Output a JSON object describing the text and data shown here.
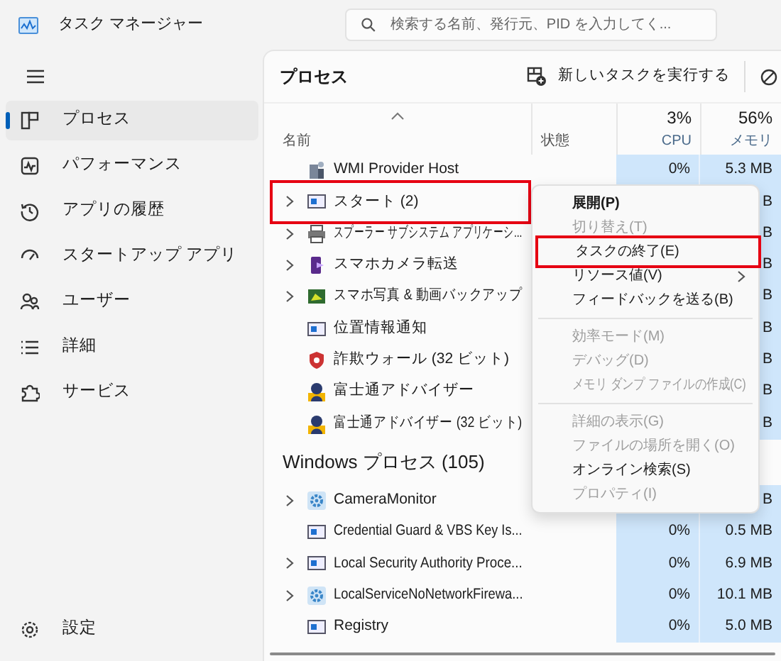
{
  "window": {
    "title": "タスク マネージャー"
  },
  "search": {
    "placeholder": "検索する名前、発行元、PID を入力してく..."
  },
  "sidebar": {
    "items": [
      {
        "label": "プロセス",
        "selected": true
      },
      {
        "label": "パフォーマンス",
        "selected": false
      },
      {
        "label": "アプリの履歴",
        "selected": false
      },
      {
        "label": "スタートアップ アプリ",
        "selected": false
      },
      {
        "label": "ユーザー",
        "selected": false
      },
      {
        "label": "詳細",
        "selected": false
      },
      {
        "label": "サービス",
        "selected": false
      }
    ],
    "footer": {
      "label": "設定"
    }
  },
  "toolbar": {
    "title": "プロセス",
    "run_task": "新しいタスクを実行する"
  },
  "table": {
    "columns": [
      {
        "label": "名前"
      },
      {
        "label": "状態"
      },
      {
        "value": "3%",
        "label": "CPU"
      },
      {
        "value": "56%",
        "label": "メモリ"
      }
    ],
    "rows": [
      {
        "kind": "process",
        "name": "WMI Provider Host",
        "expandable": false,
        "highlighted": false,
        "cpu": "0%",
        "memory": "5.3 MB"
      },
      {
        "kind": "process",
        "name": "スタート (2)",
        "expandable": true,
        "highlighted": true,
        "memory": "B"
      },
      {
        "kind": "process",
        "name": "スプーラー サブシステム アプリケーシ...",
        "expandable": true,
        "highlighted": false,
        "memory": "B"
      },
      {
        "kind": "process",
        "name": "スマホカメラ転送",
        "expandable": true,
        "highlighted": false,
        "memory": "B"
      },
      {
        "kind": "process",
        "name": "スマホ写真 & 動画バックアップ",
        "expandable": true,
        "highlighted": false,
        "memory": "B"
      },
      {
        "kind": "process",
        "name": "位置情報通知",
        "expandable": false,
        "highlighted": false,
        "memory": "B"
      },
      {
        "kind": "process",
        "name": "詐欺ウォール (32 ビット)",
        "expandable": false,
        "highlighted": false,
        "memory": "B"
      },
      {
        "kind": "process",
        "name": "富士通アドバイザー",
        "expandable": false,
        "highlighted": false,
        "memory": "B"
      },
      {
        "kind": "process",
        "name": "富士通アドバイザー (32 ビット)",
        "expandable": false,
        "highlighted": false,
        "memory": "B"
      },
      {
        "kind": "group",
        "name": "Windows プロセス (105)"
      },
      {
        "kind": "process",
        "name": "CameraMonitor",
        "expandable": true,
        "highlighted": false,
        "memory": "B"
      },
      {
        "kind": "process",
        "name": "Credential Guard & VBS Key Is...",
        "expandable": false,
        "highlighted": false,
        "cpu": "0%",
        "memory": "0.5 MB"
      },
      {
        "kind": "process",
        "name": "Local Security Authority Proce...",
        "expandable": true,
        "highlighted": false,
        "cpu": "0%",
        "memory": "6.9 MB"
      },
      {
        "kind": "process",
        "name": "LocalServiceNoNetworkFirewa...",
        "expandable": true,
        "highlighted": false,
        "cpu": "0%",
        "memory": "10.1 MB"
      },
      {
        "kind": "process",
        "name": "Registry",
        "expandable": false,
        "highlighted": false,
        "cpu": "0%",
        "memory": "5.0 MB"
      }
    ]
  },
  "context_menu": {
    "items": [
      {
        "kind": "item",
        "label": "展開(P)",
        "bold": true,
        "disabled": false,
        "highlighted": false,
        "submenu": false
      },
      {
        "kind": "item",
        "label": "切り替え(T)",
        "bold": false,
        "disabled": true,
        "highlighted": false,
        "submenu": false
      },
      {
        "kind": "item",
        "label": "タスクの終了(E)",
        "bold": false,
        "disabled": false,
        "highlighted": true,
        "submenu": false
      },
      {
        "kind": "item",
        "label": "リソース値(V)",
        "bold": false,
        "disabled": false,
        "highlighted": false,
        "submenu": true
      },
      {
        "kind": "item",
        "label": "フィードバックを送る(B)",
        "bold": false,
        "disabled": false,
        "highlighted": false,
        "submenu": false
      },
      {
        "kind": "separator"
      },
      {
        "kind": "item",
        "label": "効率モード(M)",
        "bold": false,
        "disabled": true,
        "highlighted": false,
        "submenu": false
      },
      {
        "kind": "item",
        "label": "デバッグ(D)",
        "bold": false,
        "disabled": true,
        "highlighted": false,
        "submenu": false
      },
      {
        "kind": "item",
        "label": "メモリ ダンプ ファイルの作成(C)",
        "bold": false,
        "disabled": true,
        "highlighted": false,
        "submenu": false
      },
      {
        "kind": "separator"
      },
      {
        "kind": "item",
        "label": "詳細の表示(G)",
        "bold": false,
        "disabled": true,
        "highlighted": false,
        "submenu": false
      },
      {
        "kind": "item",
        "label": "ファイルの場所を開く(O)",
        "bold": false,
        "disabled": true,
        "highlighted": false,
        "submenu": false
      },
      {
        "kind": "item",
        "label": "オンライン検索(S)",
        "bold": false,
        "disabled": false,
        "highlighted": false,
        "submenu": false
      },
      {
        "kind": "item",
        "label": "プロパティ(I)",
        "bold": false,
        "disabled": true,
        "highlighted": false,
        "submenu": false
      }
    ]
  }
}
